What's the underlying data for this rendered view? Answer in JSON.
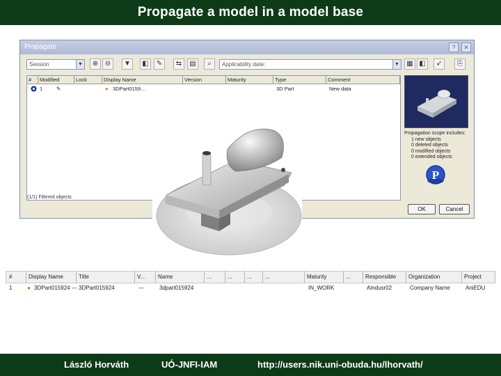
{
  "slide": {
    "title": "Propagate a model in a model base",
    "footer": {
      "author": "László Horváth",
      "institution": "UÓ-JNFI-IAM",
      "url": "http://users.nik.uni-obuda.hu/lhorvath/"
    }
  },
  "dialog": {
    "title": "Propagate",
    "help_btn": "?",
    "close_btn": "✕",
    "session_combo": "Session",
    "applicability_combo": "Applicability date:",
    "columns": [
      "#",
      "Modified",
      "Lock",
      "Display Name",
      "Version",
      "Maturity",
      "Type",
      "Comment"
    ],
    "row": {
      "num": "1",
      "display_name": "3DPart0159…",
      "type": "3D Part",
      "comment": "New data"
    },
    "status": "(1/1) Filtered objects",
    "scope_heading": "Propagation scope includes:",
    "scope_items": [
      "1 new objects",
      "0 deleted objects",
      "0 modified objects",
      "0 extended objects"
    ],
    "ok_label": "OK",
    "cancel_label": "Cancel"
  },
  "results_table": {
    "columns": [
      "#",
      "Display Name",
      "Title",
      "V...",
      "Name",
      "...",
      "...",
      "...",
      "...",
      "Maturity",
      "...",
      "Responsible",
      "Organization",
      "Project"
    ],
    "row": {
      "num": "1",
      "display_name": "3DPart015924 ---",
      "title": "3DPart015924",
      "version": "---",
      "name": "3dpart015924",
      "maturity": "IN_WORK",
      "responsible": "Aindusr02",
      "organization": "Company Name",
      "project": "AniEDU"
    }
  },
  "colors": {
    "band": "#0d3b17",
    "dialog_bg": "#ece9d8"
  }
}
